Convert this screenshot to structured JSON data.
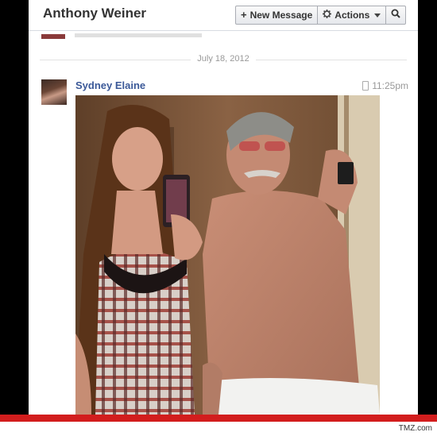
{
  "header": {
    "title": "Anthony Weiner",
    "new_message_label": "New Message",
    "actions_label": "Actions"
  },
  "thread": {
    "date": "July 18, 2012"
  },
  "message": {
    "sender": "Sydney Elaine",
    "time": "11:25pm"
  },
  "footer": {
    "credit": "TMZ.com"
  },
  "colors": {
    "link": "#3b5998",
    "footer_bar": "#d21d1d"
  }
}
